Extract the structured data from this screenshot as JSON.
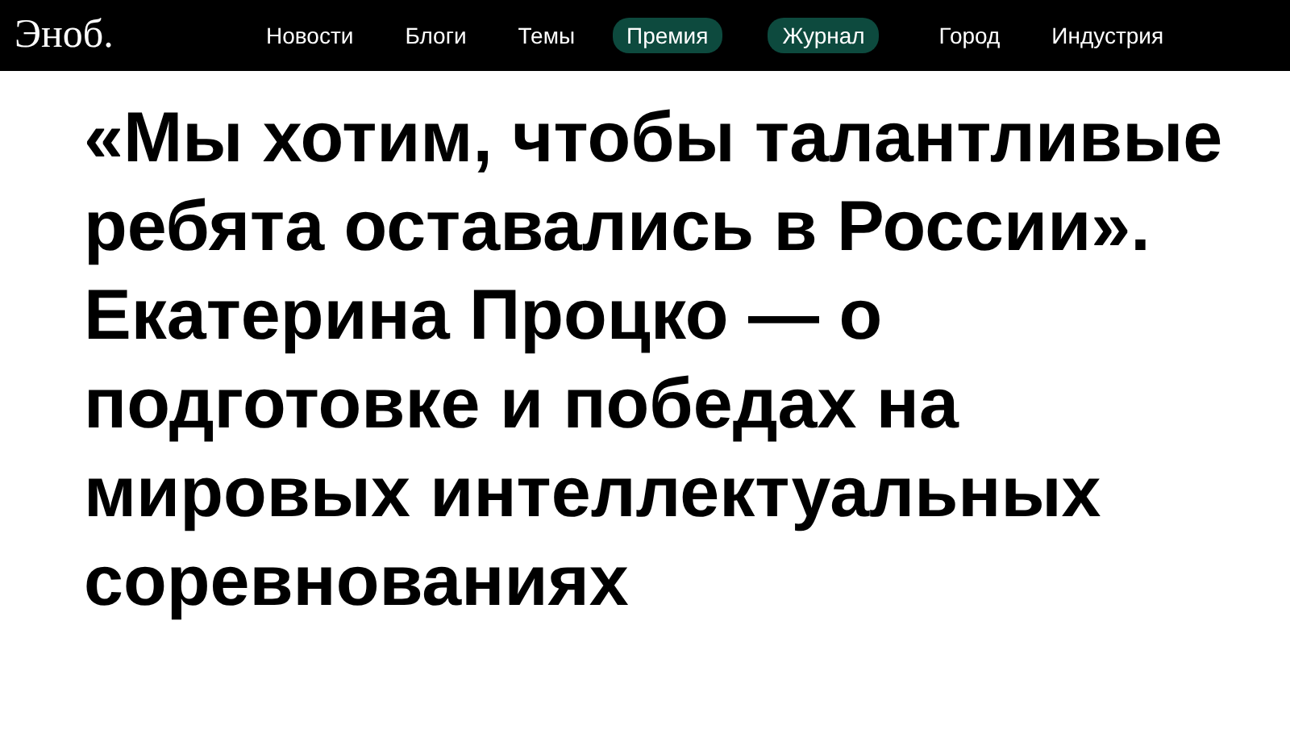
{
  "header": {
    "logo": "Эноб.",
    "nav": [
      {
        "label": "Новости",
        "highlighted": false
      },
      {
        "label": "Блоги",
        "highlighted": false
      },
      {
        "label": "Темы",
        "highlighted": false
      },
      {
        "label": "Премия",
        "highlighted": true
      },
      {
        "label": "Журнал",
        "highlighted": true
      },
      {
        "label": "Город",
        "highlighted": false
      },
      {
        "label": "Индустрия",
        "highlighted": false
      }
    ]
  },
  "article": {
    "headline": "«Мы хотим, чтобы талантливые ребята оставались в России». Екатерина Процко — о подготовке и победах на мировых интеллектуальных соревнованиях"
  }
}
